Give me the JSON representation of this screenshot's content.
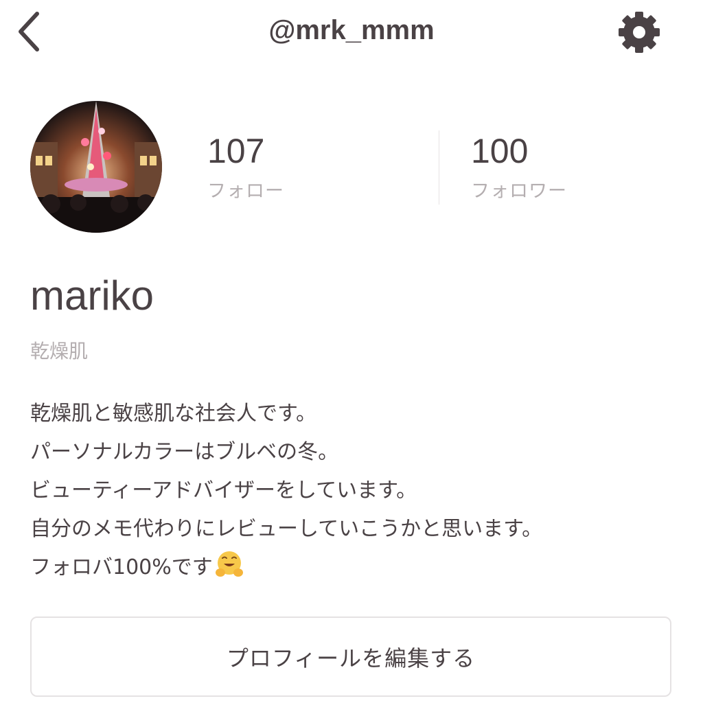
{
  "header": {
    "username": "@mrk_mmm",
    "back_icon": "chevron-left-icon",
    "settings_icon": "gear-icon"
  },
  "profile": {
    "following_count": "107",
    "following_label": "フォロー",
    "followers_count": "100",
    "followers_label": "フォロワー",
    "display_name": "mariko",
    "skin_type": "乾燥肌",
    "bio_lines": [
      "乾燥肌と敏感肌な社会人です。",
      "パーソナルカラーはブルベの冬。",
      "ビューティーアドバイザーをしています。",
      "自分のメモ代わりにレビューしていこうかと思います。",
      "フォロバ100%です"
    ],
    "bio_emoji": "hugging-face-emoji"
  },
  "actions": {
    "edit_profile_label": "プロフィールを編集する"
  },
  "colors": {
    "text": "#4a4245",
    "muted": "#b4aeb0",
    "border": "#e5e2e3"
  }
}
